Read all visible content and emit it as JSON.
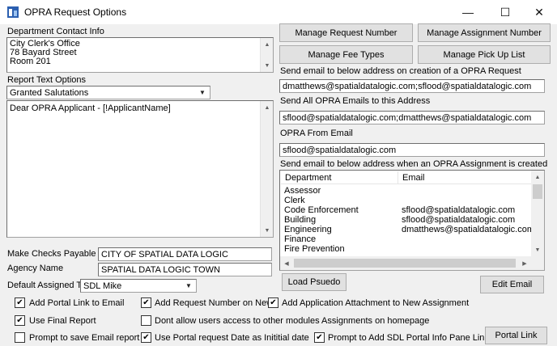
{
  "window": {
    "title": "OPRA Request Options",
    "minimize": "—",
    "maximize": "☐",
    "close": "✕"
  },
  "dept_contact": {
    "label": "Department Contact Info",
    "lines": [
      "City Clerk's Office",
      "78 Bayard Street",
      "Room 201"
    ]
  },
  "report_text": {
    "label": "Report Text Options",
    "selected": "Granted Salutations",
    "body": "Dear OPRA Applicant - [!ApplicantName]"
  },
  "buttons": {
    "manage_request_number": "Manage Request Number",
    "manage_assignment_number": "Manage Assignment Number",
    "manage_fee_types": "Manage Fee Types",
    "manage_pick_up_list": "Manage Pick Up List",
    "load_psuedo": "Load Psuedo",
    "edit_email": "Edit Email",
    "portal_link": "Portal Link"
  },
  "emails": {
    "creation_label": "Send email to below address on creation of a OPRA Request",
    "creation_value": "dmatthews@spatialdatalogic.com;sflood@spatialdatalogic.com",
    "all_label": "Send All OPRA Emails to this Address",
    "all_value": "sflood@spatialdatalogic.com;dmatthews@spatialdatalogic.com",
    "from_label": "OPRA From Email",
    "from_value": "sflood@spatialdatalogic.com",
    "assignment_label": "Send email to below address when an OPRA Assignment is created"
  },
  "assignment_table": {
    "columns": [
      "Department",
      "Email"
    ],
    "rows": [
      {
        "department": "Assessor",
        "email": ""
      },
      {
        "department": "Clerk",
        "email": ""
      },
      {
        "department": "Code Enforcement",
        "email": "sflood@spatialdatalogic.com"
      },
      {
        "department": "Building",
        "email": "sflood@spatialdatalogic.com"
      },
      {
        "department": "Engineering",
        "email": "dmatthews@spatialdatalogic.com"
      },
      {
        "department": "Finance",
        "email": ""
      },
      {
        "department": "Fire Prevention",
        "email": ""
      }
    ]
  },
  "payable": {
    "label": "Make Checks Payable to",
    "value": "CITY OF SPATIAL DATA LOGIC"
  },
  "agency": {
    "label": "Agency Name",
    "value": "SPATIAL DATA LOGIC TOWN"
  },
  "default_assigned": {
    "label": "Default Assigned To",
    "value": "SDL Mike"
  },
  "options": {
    "add_portal_link": {
      "label": "Add Portal Link to Email",
      "checked": true
    },
    "add_request_number": {
      "label": "Add Request Number on New",
      "checked": true
    },
    "add_app_attachment": {
      "label": "Add Application Attachment to New Assignment",
      "checked": true
    },
    "use_final_report": {
      "label": "Use Final Report",
      "checked": true
    },
    "dont_allow_users": {
      "label": "Dont allow users access to other modules Assignments on homepage",
      "checked": false
    },
    "prompt_save_email": {
      "label": "Prompt to save Email report",
      "checked": false
    },
    "use_portal_date": {
      "label": "Use Portal request Date as Inititial date",
      "checked": true
    },
    "prompt_sdl_portal": {
      "label": "Prompt to Add SDL Portal Info Pane Link",
      "checked": true
    }
  },
  "colors": {
    "app_icon_blue": "#2b5fb0",
    "border": "#a0a0a0",
    "button_face": "#e1e1e1"
  }
}
